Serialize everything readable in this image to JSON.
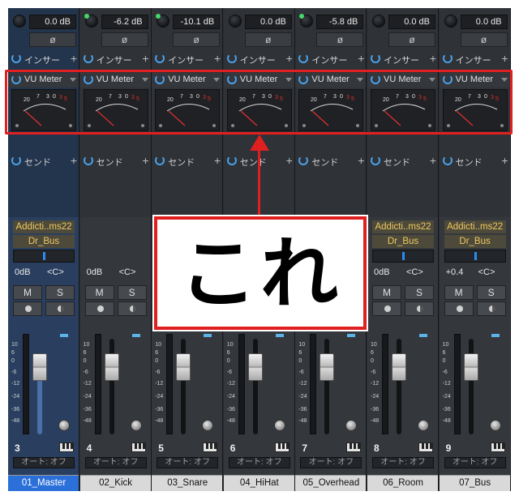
{
  "mixer": {
    "insert_label": "インサー",
    "vu_label": "VU Meter",
    "send_label": "センド",
    "auto_label": "オート: オフ",
    "phase_symbol": "ø",
    "mute_label": "M",
    "solo_label": "S",
    "vu_scale": [
      "20",
      "7",
      "3",
      "0",
      "3",
      "5"
    ],
    "fader_scale": [
      "10",
      "6",
      "0",
      "-6",
      "-12",
      "-24",
      "-36",
      "-48"
    ],
    "annotation": "これ",
    "channels": [
      {
        "name": "01_Master",
        "number": "3",
        "gain": "0.0 dB",
        "gain_active": false,
        "plugin": "Addicti..ms22",
        "bus": "Dr_Bus",
        "volume": "0dB",
        "pan": "<C>",
        "selected": true
      },
      {
        "name": "02_Kick",
        "number": "4",
        "gain": "-6.2 dB",
        "gain_active": true,
        "plugin": "",
        "bus": "",
        "volume": "0dB",
        "pan": "<C>",
        "selected": false
      },
      {
        "name": "03_Snare",
        "number": "5",
        "gain": "-10.1 dB",
        "gain_active": true,
        "plugin": "",
        "bus": "",
        "volume": "",
        "pan": "",
        "selected": false
      },
      {
        "name": "04_HiHat",
        "number": "6",
        "gain": "0.0 dB",
        "gain_active": false,
        "plugin": "",
        "bus": "",
        "volume": "",
        "pan": "",
        "selected": false
      },
      {
        "name": "05_Overhead",
        "number": "7",
        "gain": "-5.8 dB",
        "gain_active": true,
        "plugin": "",
        "bus": "",
        "volume": "",
        "pan": "",
        "selected": false
      },
      {
        "name": "06_Room",
        "number": "8",
        "gain": "0.0 dB",
        "gain_active": false,
        "plugin": "Addicti..ms22",
        "bus": "Dr_Bus",
        "volume": "0dB",
        "pan": "<C>",
        "selected": false
      },
      {
        "name": "07_Bus",
        "number": "9",
        "gain": "0.0 dB",
        "gain_active": false,
        "plugin": "Addicti..ms22",
        "bus": "Dr_Bus",
        "volume": "+0.4",
        "pan": "<C>",
        "selected": false
      }
    ]
  }
}
